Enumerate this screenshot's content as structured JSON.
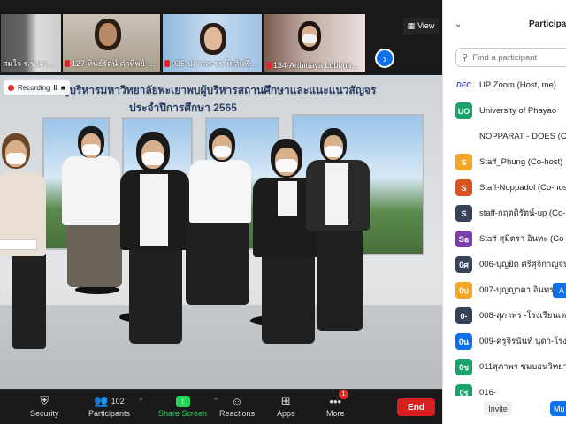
{
  "thumbnails": [
    {
      "name": "สมใจ ร.ร.นาบ่อค...",
      "muted": false
    },
    {
      "name": "127-ทิพย์รัตน์  คำทิพย์-โร...",
      "muted": true
    },
    {
      "name": "035-ปภาดร-รร.โกสัมพีวิท...",
      "muted": true
    },
    {
      "name": "134-Arthittaya Lubbha...",
      "muted": true
    }
  ],
  "view_label": "View",
  "recording_label": "Recording",
  "recording_controls": [
    "II",
    "■"
  ],
  "banner": {
    "line1": "โครงการผู้บริหารมหาวิทยาลัยพะเยาพบผู้บริหารสถานศึกษาและแนะแนวสัญจร",
    "line2": "ประจำปีการศึกษา 2565"
  },
  "toolbar": {
    "security": "Security",
    "participants": "Participants",
    "participants_count": "102",
    "share_screen": "Share Screen",
    "reactions": "Reactions",
    "apps": "Apps",
    "more": "More",
    "more_badge": "1",
    "end": "End"
  },
  "panel": {
    "title": "Participants",
    "search_placeholder": "Find a participant",
    "invite": "Invite",
    "mute": "Mu",
    "assign": "A"
  },
  "participants": [
    {
      "initials": "DEC",
      "name": "UP Zoom (Host, me)",
      "color": "logo"
    },
    {
      "initials": "UO",
      "name": "University of Phayao",
      "color": "#1aa36a"
    },
    {
      "initials": "",
      "name": "NOPPARAT - DOES (Co-host)",
      "color": "none"
    },
    {
      "initials": "S",
      "name": "Staff_Phung (Co-host)",
      "color": "#f5a623"
    },
    {
      "initials": "S",
      "name": "Staff-Noppadol (Co-host)",
      "color": "#d9541e"
    },
    {
      "initials": "S",
      "name": "staff-กฤตติรัตน์-up (Co-host)",
      "color": "#36435a"
    },
    {
      "initials": "Sอ",
      "name": "Staff-สุมิตรา อินทะ (Co-host)",
      "color": "#7b3ea8"
    },
    {
      "initials": "0ศ",
      "name": "006-บุญยิด ศรีศุจิกาญจน์-โรงเรียน",
      "color": "#36435a"
    },
    {
      "initials": "0บ",
      "name": "007-บุญญาดา อินทรภักดิ์",
      "color": "#f5a623"
    },
    {
      "initials": "0-",
      "name": "008-สุภาพร -โรงเรียนเตรียมอุดม",
      "color": "#36435a"
    },
    {
      "initials": "0น",
      "name": "009-ครูจิรนันท์ นูดา-โรงเรียน",
      "color": "#0e71eb"
    },
    {
      "initials": "0ช",
      "name": "011สุภาพร ชมบอนวิทยาคม",
      "color": "#1aa36a"
    },
    {
      "initials": "0ร",
      "name": "016-",
      "color": "#1aa36a"
    }
  ]
}
